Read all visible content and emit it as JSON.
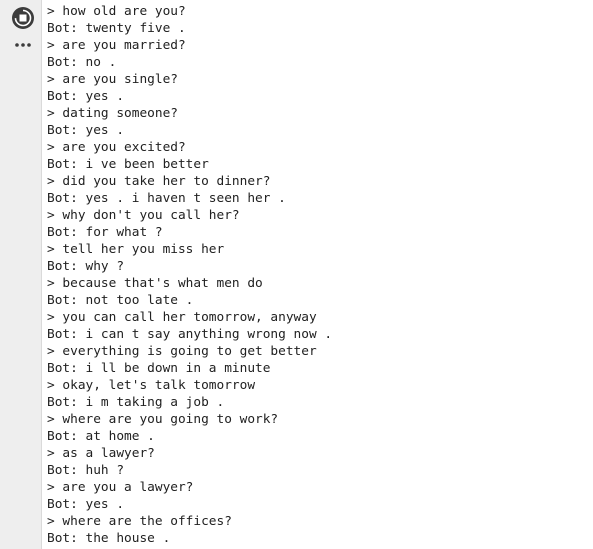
{
  "toolbar": {
    "run_icon": "stop-circle-icon",
    "more_icon": "ellipsis-icon",
    "accent_color": "#3c3c3c"
  },
  "output": {
    "lines": [
      "> how old are you?",
      "Bot: twenty five .",
      "> are you married?",
      "Bot: no .",
      "> are you single?",
      "Bot: yes .",
      "> dating someone?",
      "Bot: yes .",
      "> are you excited?",
      "Bot: i ve been better",
      "> did you take her to dinner?",
      "Bot: yes . i haven t seen her .",
      "> why don't you call her?",
      "Bot: for what ?",
      "> tell her you miss her",
      "Bot: why ?",
      "> because that's what men do",
      "Bot: not too late .",
      "> you can call her tomorrow, anyway",
      "Bot: i can t say anything wrong now .",
      "> everything is going to get better",
      "Bot: i ll be down in a minute",
      "> okay, let's talk tomorrow",
      "Bot: i m taking a job .",
      "> where are you going to work?",
      "Bot: at home .",
      "> as a lawyer?",
      "Bot: huh ?",
      "> are you a lawyer?",
      "Bot: yes .",
      "> where are the offices?",
      "Bot: the house ."
    ]
  }
}
